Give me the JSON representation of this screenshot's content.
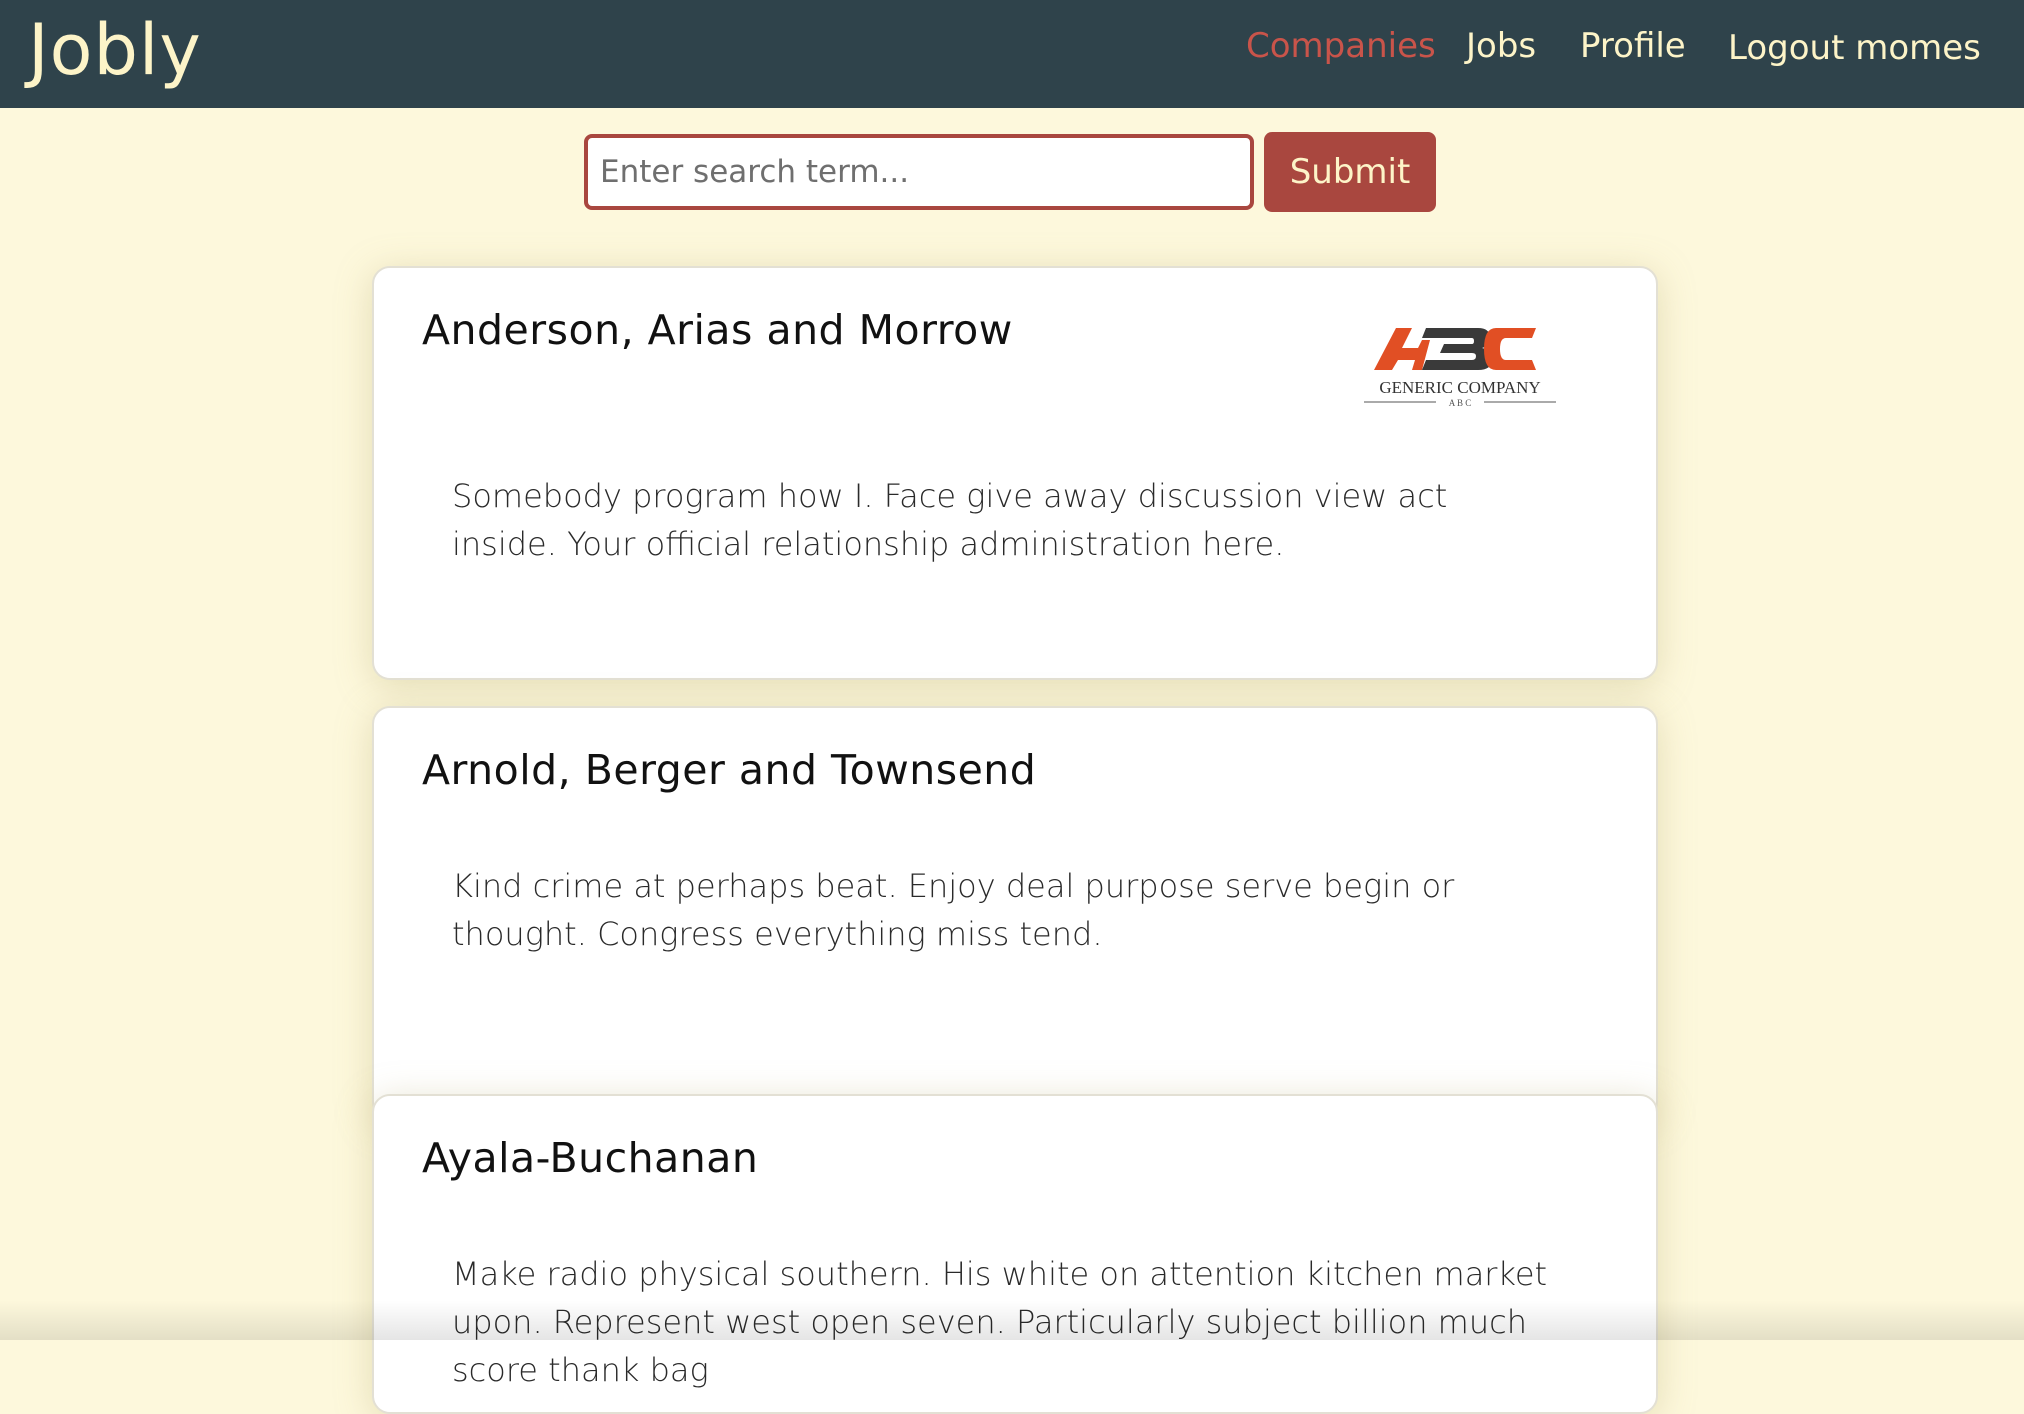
{
  "navbar": {
    "brand": "Jobly",
    "links": {
      "companies": "Companies",
      "jobs": "Jobs",
      "profile": "Profile",
      "logout": "Logout momes"
    },
    "active": "companies",
    "active_color": "#c9544a",
    "background": "#2f434b",
    "text_color": "#fdf4c8"
  },
  "search": {
    "placeholder": "Enter search term...",
    "value": "",
    "submit_label": "Submit",
    "accent": "#a9473f"
  },
  "companies": [
    {
      "name": "Anderson, Arias and Morrow",
      "description": "Somebody program how I. Face give away discussion view act inside. Your official relationship administration here.",
      "logo": {
        "letters": "ABC",
        "caption": "GENERIC COMPANY",
        "subcaption": "A B C"
      }
    },
    {
      "name": "Arnold, Berger and Townsend",
      "description": "Kind crime at perhaps beat. Enjoy deal purpose serve begin or thought. Congress everything miss tend."
    },
    {
      "name": "Ayala-Buchanan",
      "description": "Make radio physical southern. His white on attention kitchen market upon. Represent west open seven. Particularly subject billion much score thank bag"
    }
  ],
  "page_background": "#fdf8dc"
}
